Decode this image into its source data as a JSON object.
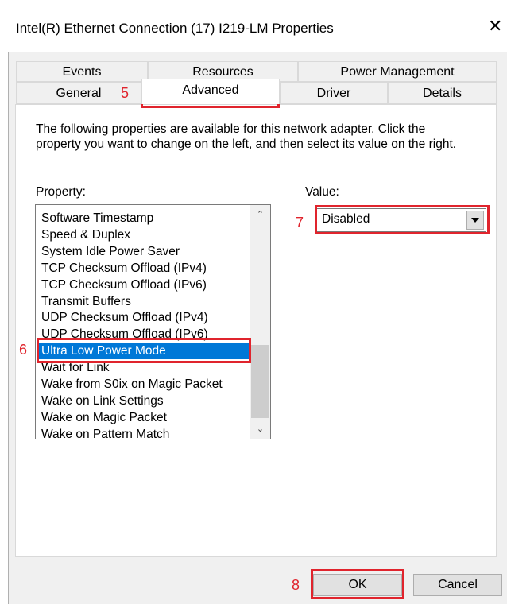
{
  "window": {
    "title": "Intel(R) Ethernet Connection (17) I219-LM Properties",
    "close_glyph": "✕"
  },
  "tabs": {
    "row1": [
      "Events",
      "Resources",
      "Power Management"
    ],
    "row2": [
      "General",
      "Advanced",
      "Driver",
      "Details"
    ],
    "active": "Advanced"
  },
  "advanced": {
    "description": "The following properties are available for this network adapter. Click the property you want to change on the left, and then select its value on the right.",
    "property_label": "Property:",
    "value_label": "Value:",
    "properties": [
      "Software Timestamp",
      "Speed & Duplex",
      "System Idle Power Saver",
      "TCP Checksum Offload (IPv4)",
      "TCP Checksum Offload (IPv6)",
      "Transmit Buffers",
      "UDP Checksum Offload (IPv4)",
      "UDP Checksum Offload (IPv6)",
      "Ultra Low Power Mode",
      "Wait for Link",
      "Wake from S0ix on Magic Packet",
      "Wake on Link Settings",
      "Wake on Magic Packet",
      "Wake on Pattern Match"
    ],
    "selected_property": "Ultra Low Power Mode",
    "value": "Disabled",
    "scroll_up_glyph": "⌃",
    "scroll_down_glyph": "⌄"
  },
  "buttons": {
    "ok": "OK",
    "cancel": "Cancel"
  },
  "annotations": {
    "color": "#e0242d",
    "step_advanced_tab": "5",
    "step_property": "6",
    "step_value": "7",
    "step_ok": "8"
  },
  "colors": {
    "selection": "#0078d7",
    "panel": "#ffffff",
    "background": "#f0f0f0"
  }
}
